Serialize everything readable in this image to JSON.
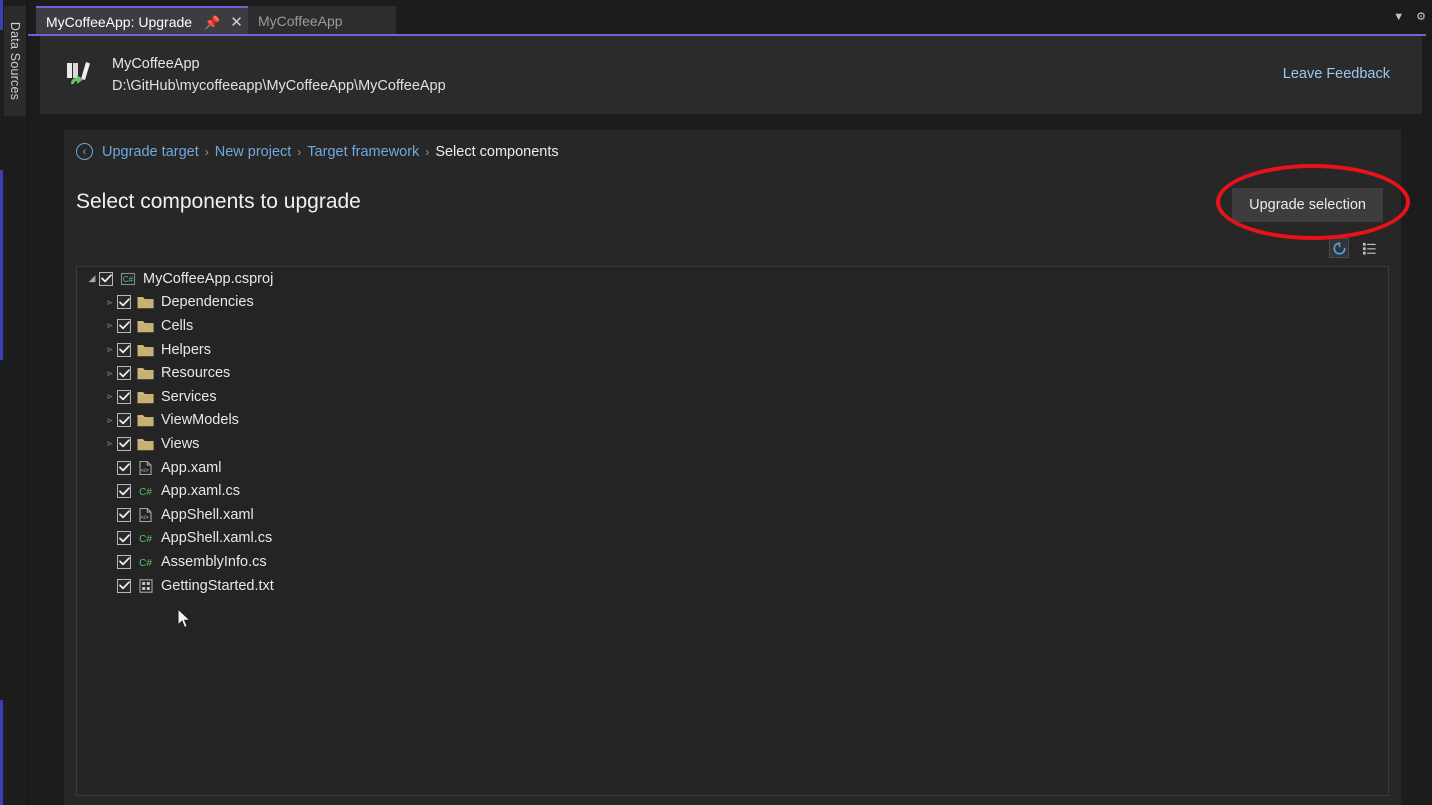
{
  "dock": {
    "label": "Data Sources"
  },
  "tabs": [
    {
      "title": "MyCoffeeApp: Upgrade",
      "active": true,
      "pin_icon": "pin-icon",
      "close_icon": "close-icon"
    },
    {
      "title": "MyCoffeeApp",
      "active": false
    }
  ],
  "window_controls": [
    {
      "name": "chevron-down-icon",
      "glyph": "▼"
    },
    {
      "name": "gear-icon",
      "glyph": "⚙"
    }
  ],
  "project_header": {
    "icon": "upgrade-assistant-icon",
    "name": "MyCoffeeApp",
    "path": "D:\\GitHub\\mycoffeeapp\\MyCoffeeApp\\MyCoffeeApp",
    "feedback_label": "Leave Feedback"
  },
  "breadcrumb": {
    "back_icon": "back-arrow-icon",
    "items": [
      {
        "label": "Upgrade target",
        "current": false
      },
      {
        "label": "New project",
        "current": false
      },
      {
        "label": "Target framework",
        "current": false
      },
      {
        "label": "Select components",
        "current": true
      }
    ],
    "separator": "›"
  },
  "page": {
    "title": "Select components to upgrade",
    "upgrade_button": "Upgrade selection"
  },
  "tool_icons": [
    {
      "name": "refresh-icon",
      "selected": true
    },
    {
      "name": "list-details-icon",
      "selected": false
    }
  ],
  "tree": [
    {
      "label": "MyCoffeeApp.csproj",
      "indent": 0,
      "twisty": "expanded",
      "checked": true,
      "icon": "csharp-project-icon"
    },
    {
      "label": "Dependencies",
      "indent": 1,
      "twisty": "collapsed",
      "checked": true,
      "icon": "folder-icon"
    },
    {
      "label": "Cells",
      "indent": 1,
      "twisty": "collapsed",
      "checked": true,
      "icon": "folder-icon"
    },
    {
      "label": "Helpers",
      "indent": 1,
      "twisty": "collapsed",
      "checked": true,
      "icon": "folder-icon"
    },
    {
      "label": "Resources",
      "indent": 1,
      "twisty": "collapsed",
      "checked": true,
      "icon": "folder-icon"
    },
    {
      "label": "Services",
      "indent": 1,
      "twisty": "collapsed",
      "checked": true,
      "icon": "folder-icon"
    },
    {
      "label": "ViewModels",
      "indent": 1,
      "twisty": "collapsed",
      "checked": true,
      "icon": "folder-icon"
    },
    {
      "label": "Views",
      "indent": 1,
      "twisty": "collapsed",
      "checked": true,
      "icon": "folder-icon"
    },
    {
      "label": "App.xaml",
      "indent": 1,
      "twisty": "none",
      "checked": true,
      "icon": "xaml-file-icon"
    },
    {
      "label": "App.xaml.cs",
      "indent": 1,
      "twisty": "none",
      "checked": true,
      "icon": "csharp-file-icon"
    },
    {
      "label": "AppShell.xaml",
      "indent": 1,
      "twisty": "none",
      "checked": true,
      "icon": "xaml-file-icon"
    },
    {
      "label": "AppShell.xaml.cs",
      "indent": 1,
      "twisty": "none",
      "checked": true,
      "icon": "csharp-file-icon"
    },
    {
      "label": "AssemblyInfo.cs",
      "indent": 1,
      "twisty": "none",
      "checked": true,
      "icon": "csharp-file-icon"
    },
    {
      "label": "GettingStarted.txt",
      "indent": 1,
      "twisty": "none",
      "checked": true,
      "icon": "text-file-icon"
    }
  ],
  "annotation": {
    "shape": "ellipse",
    "color": "#e8131a",
    "targets": "upgrade-selection-button"
  },
  "colors": {
    "window_bg": "#1c1c1c",
    "panel_bg": "#272728",
    "header_bg": "#2b2b2c",
    "tree_bg": "#242425",
    "tab_active_bg": "#3c3c41",
    "accent_purple": "#6f62d6",
    "link_blue": "#6ea8dc",
    "annotation_red": "#e8131a",
    "folder_yellow": "#c8b273",
    "csharp_green": "#66bb6a"
  }
}
